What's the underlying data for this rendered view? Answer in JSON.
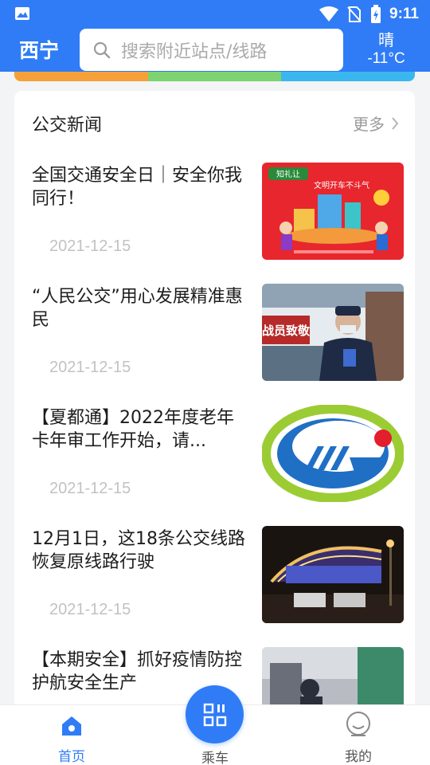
{
  "status_bar": {
    "time": "9:11",
    "icons": [
      "image-icon",
      "wifi-icon",
      "no-sim-icon",
      "battery-charging-icon"
    ]
  },
  "header": {
    "city": "西宁",
    "search_placeholder": "搜索附近站点/线路",
    "weather": {
      "condition": "晴",
      "temperature": "-11°C"
    }
  },
  "news": {
    "section_title": "公交新闻",
    "more_label": "更多",
    "items": [
      {
        "title": "全国交通安全日｜安全你我同行！",
        "date": "2021-12-15",
        "thumb_caption": "知礼让 文明开车不斗气"
      },
      {
        "title": "“人民公交”用心发展精准惠民",
        "date": "2021-12-15",
        "thumb_caption": "战员致敬"
      },
      {
        "title": "【夏都通】2022年度老年卡年审工作开始，请...",
        "date": "2021-12-15",
        "thumb_caption": ""
      },
      {
        "title": "12月1日，这18条公交线路恢复原线路行驶",
        "date": "2021-12-15",
        "thumb_caption": ""
      },
      {
        "title": "【本期安全】抓好疫情防控 护航安全生产",
        "date": "",
        "thumb_caption": ""
      }
    ]
  },
  "bottom_nav": {
    "home": "首页",
    "ride": "乘车",
    "me": "我的"
  },
  "colors": {
    "primary": "#2f7cf6",
    "date_text": "#c2c2c2"
  }
}
